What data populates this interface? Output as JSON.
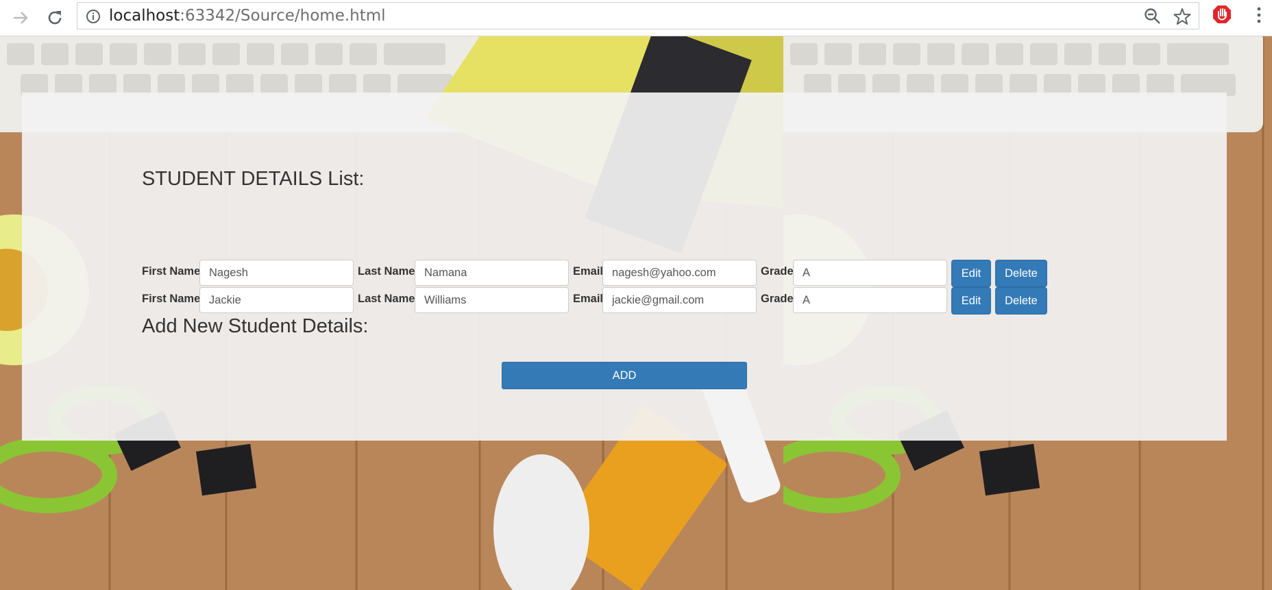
{
  "browser": {
    "url_host": "localhost",
    "url_path": ":63342/Source/home.html"
  },
  "page": {
    "list_title": "STUDENT DETAILS List:",
    "add_title": "Add New Student Details:",
    "labels": {
      "first_name": "First Name",
      "last_name": "Last Name",
      "email": "Email",
      "grade": "Grade"
    },
    "buttons": {
      "edit": "Edit",
      "delete": "Delete",
      "add": "ADD"
    },
    "students": [
      {
        "first_name": "Nagesh",
        "last_name": "Namana",
        "email": "nagesh@yahoo.com",
        "grade": "A"
      },
      {
        "first_name": "Jackie",
        "last_name": "Williams",
        "email": "jackie@gmail.com",
        "grade": "A"
      }
    ]
  },
  "colors": {
    "primary_button": "#337ab7",
    "panel": "#f2f2f2",
    "wood": "#b9865a"
  }
}
